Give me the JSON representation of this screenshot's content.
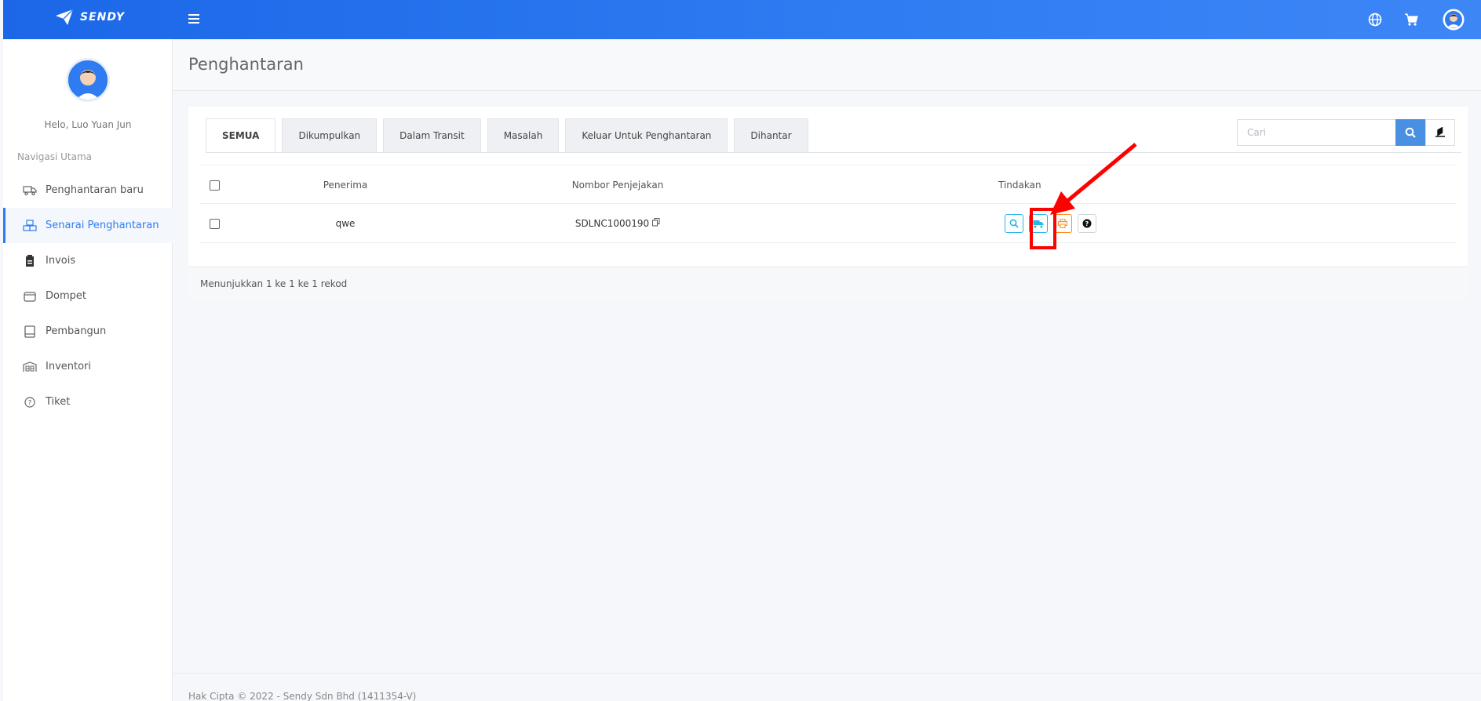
{
  "topbar": {
    "logo_text": "SENDY",
    "icons": [
      "menu-icon",
      "globe-icon",
      "cart-icon",
      "user-avatar"
    ]
  },
  "sidebar": {
    "greeting": "Helo, Luo Yuan Jun",
    "nav_title": "Navigasi Utama",
    "items": [
      {
        "label": "Penghantaran baru",
        "icon": "truck-icon"
      },
      {
        "label": "Senarai Penghantaran",
        "icon": "boxes-icon",
        "active": true
      },
      {
        "label": "Invois",
        "icon": "invoice-icon"
      },
      {
        "label": "Dompet",
        "icon": "wallet-icon"
      },
      {
        "label": "Pembangun",
        "icon": "book-icon"
      },
      {
        "label": "Inventori",
        "icon": "warehouse-icon"
      },
      {
        "label": "Tiket",
        "icon": "question-circle-icon"
      }
    ]
  },
  "page": {
    "title": "Penghantaran"
  },
  "tabs": [
    "SEMUA",
    "Dikumpulkan",
    "Dalam Transit",
    "Masalah",
    "Keluar Untuk Penghantaran",
    "Dihantar"
  ],
  "search": {
    "placeholder": "Cari"
  },
  "table": {
    "headers": {
      "recipient": "Penerima",
      "tracking": "Nombor Penjejakan",
      "actions": "Tindakan"
    },
    "rows": [
      {
        "recipient": "qwe",
        "tracking": "SDLNC1000190"
      }
    ]
  },
  "card_footer": "Menunjukkan 1 ke 1 ke 1 rekod",
  "footer": "Hak Cipta © 2022 - Sendy Sdn Bhd (1411354-V)",
  "colors": {
    "primary": "#2f7cf2",
    "accent_cyan": "#29b6e6",
    "accent_orange": "#ff8c1a",
    "annotation_red": "#ff0000"
  }
}
